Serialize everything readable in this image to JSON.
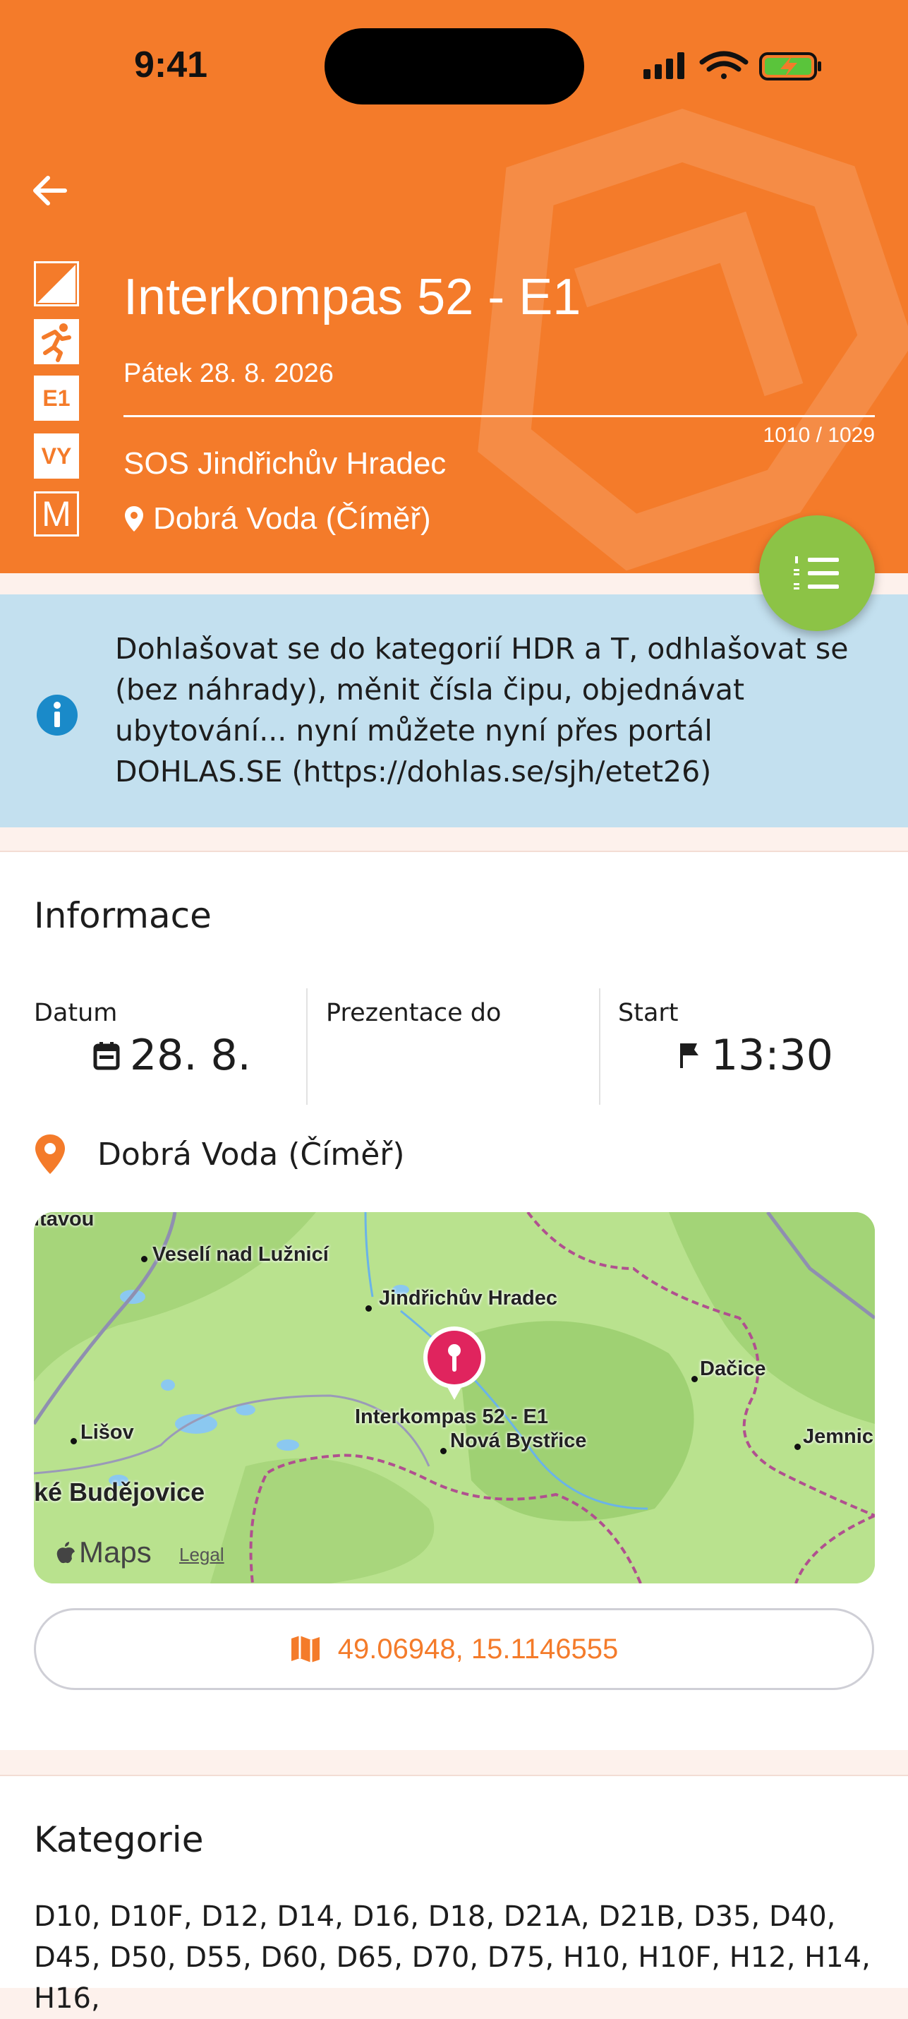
{
  "status": {
    "time": "9:41"
  },
  "header": {
    "title": "Interkompas 52 - E1",
    "date": "Pátek 28. 8. 2026",
    "counter": "1010 / 1029",
    "organizer": "SOS Jindřichův Hradec",
    "place": "Dobrá Voda (Číměř)",
    "badges": [
      "E1",
      "VY",
      "M"
    ]
  },
  "banner": {
    "text": "Dohlašovat se do kategorií HDR a T, odhlašovat se (bez náhrady), měnit čísla čipu, objednávat ubytování... nyní můžete nyní přes portál DOHLAS.SE (https://dohlas.se/sjh/etet26)"
  },
  "info": {
    "title": "Informace",
    "date_label": "Datum",
    "date_value": "28. 8.",
    "presentation_label": "Prezentace do",
    "start_label": "Start",
    "start_value": "13:30",
    "location": "Dobrá Voda (Číměř)"
  },
  "map": {
    "labels": {
      "vltavou": "ltavou",
      "veseli": "Veselí nad Lužnicí",
      "jhradec": "Jindřichův Hradec",
      "dacice": "Dačice",
      "lisov": "Lišov",
      "novabystrice": "Nová Bystřice",
      "budejovice": "ké Budějovice",
      "jemnice": "Jemnic",
      "pin": "Interkompas 52 - E1"
    },
    "brand": "Maps",
    "legal": "Legal"
  },
  "coords": "49.06948, 15.1146555",
  "categories": {
    "title": "Kategorie",
    "list": "D10, D10F, D12, D14, D16, D18, D21A, D21B, D35, D40, D45, D50, D55, D60, D65, D70, D75, H10, H10F, H12, H14, H16,"
  },
  "colors": {
    "accent": "#f47b2a",
    "fab": "#8cc346",
    "banner": "#c3e0ef",
    "info_icon": "#1a8ac9"
  }
}
